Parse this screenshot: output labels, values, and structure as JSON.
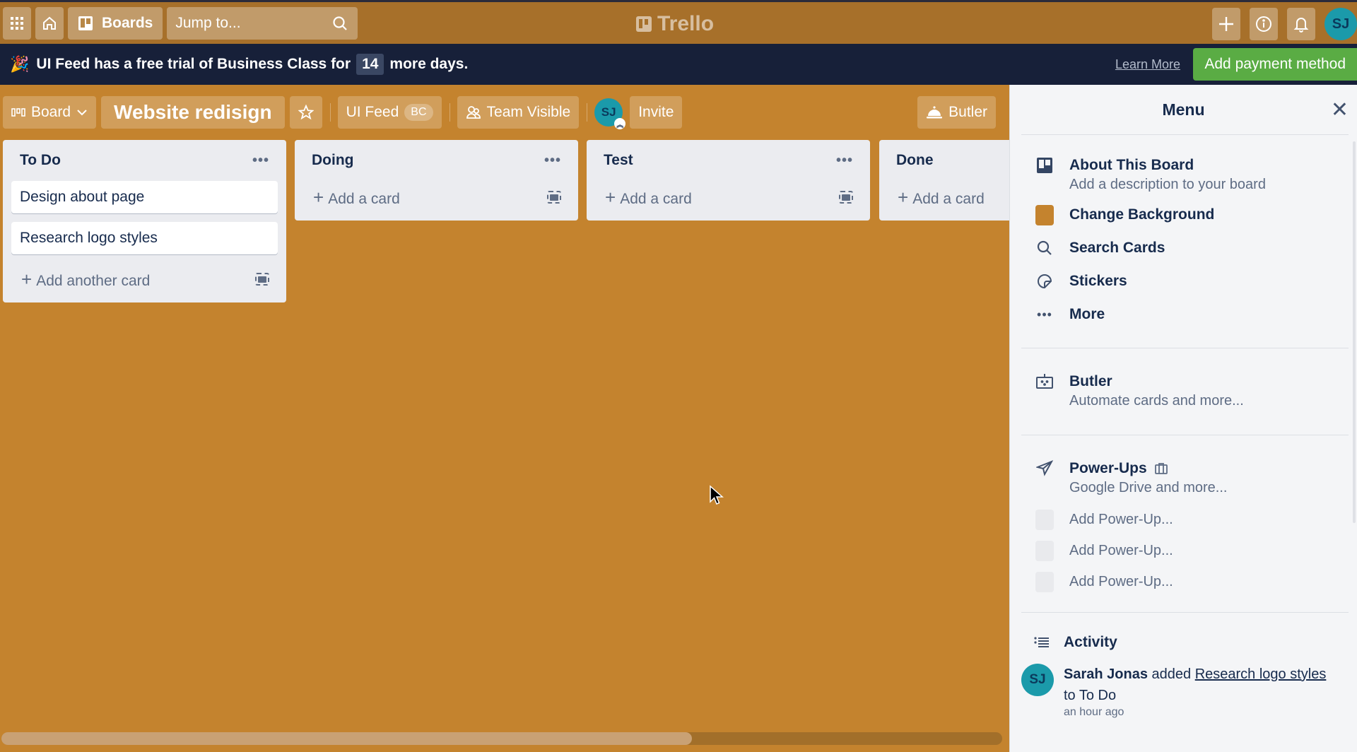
{
  "topnav": {
    "apps_icon": "grid-icon",
    "home_icon": "home-icon",
    "boards_label": "Boards",
    "search_placeholder": "Jump to...",
    "logo_text": "Trello",
    "create_icon": "plus-icon",
    "info_icon": "info-icon",
    "notifications_icon": "bell-icon",
    "user_initials": "SJ"
  },
  "banner": {
    "prefix": "UI Feed has a free trial of Business Class for",
    "days": "14",
    "suffix": "more days.",
    "learn_more": "Learn More",
    "add_payment": "Add payment method"
  },
  "board_header": {
    "view_label": "Board",
    "board_title": "Website redisign",
    "team_name": "UI Feed",
    "team_badge": "BC",
    "visibility": "Team Visible",
    "member_initials": "SJ",
    "invite_label": "Invite",
    "butler_label": "Butler"
  },
  "lists": [
    {
      "title": "To Do",
      "cards": [
        "Design about page",
        "Research logo styles"
      ],
      "add_label": "Add another card"
    },
    {
      "title": "Doing",
      "cards": [],
      "add_label": "Add a card"
    },
    {
      "title": "Test",
      "cards": [],
      "add_label": "Add a card"
    },
    {
      "title": "Done",
      "cards": [],
      "add_label": "Add a card"
    }
  ],
  "scroll": {
    "horizontal_visible_fraction": 0.69
  },
  "menu": {
    "title": "Menu",
    "about_title": "About This Board",
    "about_sub": "Add a description to your board",
    "change_bg": "Change Background",
    "bg_color": "#c4832e",
    "search_cards": "Search Cards",
    "stickers": "Stickers",
    "more": "More",
    "butler_title": "Butler",
    "butler_sub": "Automate cards and more...",
    "powerups_title": "Power-Ups",
    "powerups_sub": "Google Drive and more...",
    "add_powerup": [
      "Add Power-Up...",
      "Add Power-Up...",
      "Add Power-Up..."
    ],
    "activity_title": "Activity",
    "activity": {
      "initials": "SJ",
      "user": "Sarah Jonas",
      "action": "added",
      "card": "Research logo styles",
      "to_text": "to To Do",
      "time": "an hour ago"
    }
  }
}
